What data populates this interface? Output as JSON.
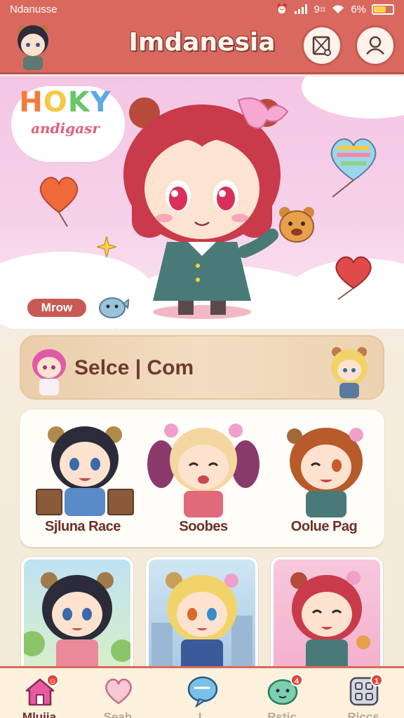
{
  "status_bar": {
    "carrier": "Ndanusse",
    "time": "9⌗",
    "battery_text": "6%",
    "battery_level": 0.61
  },
  "header": {
    "title": "Imdanesia"
  },
  "hero": {
    "brand_title": [
      "H",
      "O",
      "K",
      "Y"
    ],
    "brand_subtitle": "andigasr",
    "pill_label": "Mrow"
  },
  "select_banner": {
    "label": "Selce | Com"
  },
  "featured": {
    "items": [
      {
        "name": "Sjluna Race"
      },
      {
        "name": "Soobes"
      },
      {
        "name": "Oolue Pag"
      }
    ]
  },
  "tiles": [
    {
      "name": "tile-black-hair"
    },
    {
      "name": "tile-blonde-hair"
    },
    {
      "name": "tile-red-hair"
    }
  ],
  "bottom_nav": {
    "items": [
      {
        "label": "Mlujia",
        "active": true,
        "badge": ""
      },
      {
        "label": "Seah",
        "active": false,
        "badge": ""
      },
      {
        "label": "L",
        "active": false,
        "badge": ""
      },
      {
        "label": "Rstic",
        "active": false,
        "badge": "4"
      },
      {
        "label": "Riccs",
        "active": false,
        "badge": "1"
      }
    ]
  },
  "colors": {
    "header": "#d9695f",
    "accent_dark": "#6e2e28",
    "background": "#f5ecdc"
  }
}
